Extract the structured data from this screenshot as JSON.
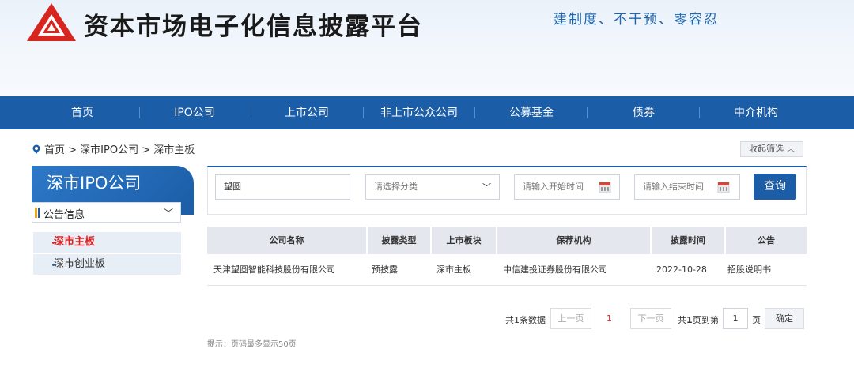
{
  "header": {
    "title": "资本市场电子化信息披露平台",
    "slogan": "建制度、不干预、零容忍",
    "colors": {
      "brand": "#d7261f",
      "nav": "#1b5da6",
      "accent": "#e02020"
    },
    "logo_icon": "triangle-logo-icon"
  },
  "nav": {
    "items": [
      "首页",
      "IPO公司",
      "上市公司",
      "非上市公众公司",
      "公募基金",
      "债券",
      "中介机构"
    ]
  },
  "breadcrumb": {
    "icon": "location-pin-icon",
    "text": "首页 > 深市IPO公司 > 深市主板"
  },
  "collapse": {
    "label": "收起筛选",
    "icon": "chevron-up-icon"
  },
  "sidebar": {
    "title": "深市IPO公司",
    "section": "公告信息",
    "links": [
      "深市主板",
      "深市创业板"
    ],
    "active_index": 0
  },
  "filter": {
    "keyword": "望圆",
    "category_placeholder": "请选择分类",
    "start_placeholder": "请输入开始时间",
    "end_placeholder": "请输入结束时间",
    "query_label": "查询"
  },
  "table": {
    "headers": [
      "公司名称",
      "披露类型",
      "上市板块",
      "保荐机构",
      "披露时间",
      "公告"
    ],
    "rows": [
      [
        "天津望圆智能科技股份有限公司",
        "预披露",
        "深市主板",
        "中信建投证券股份有限公司",
        "2022-10-28",
        "招股说明书"
      ]
    ]
  },
  "pagination": {
    "total_text": "共1条数据",
    "prev_label": "上一页",
    "current_page": "1",
    "next_label": "下一页",
    "pages_prefix": "共",
    "pages_count": "1",
    "pages_suffix": "页",
    "goto_label": "到第",
    "goto_value": "1",
    "page_unit": "页",
    "confirm_label": "确定"
  },
  "hint": "提示：页码最多显示50页"
}
